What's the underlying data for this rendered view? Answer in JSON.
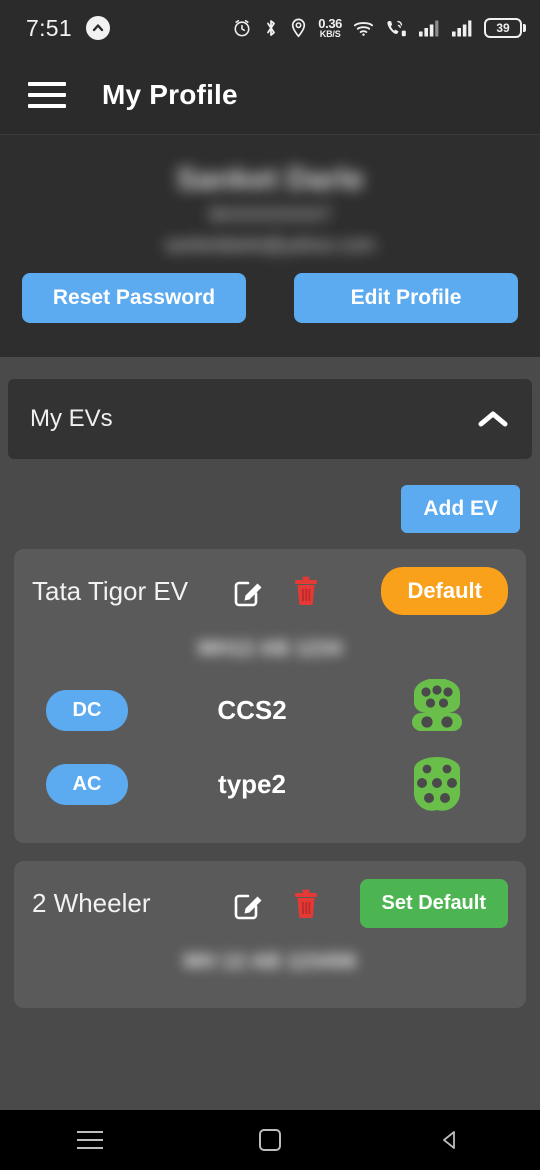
{
  "status_bar": {
    "time": "7:51",
    "app_icon": "caret-up-circle-icon",
    "icons": [
      "alarm-icon",
      "bluetooth-icon",
      "location-icon",
      "wifi-icon",
      "call-data-icon",
      "signal-bars-icon",
      "signal-bars-2-icon"
    ],
    "network_speed_value": "0.36",
    "network_speed_unit": "KB/S",
    "battery_level": "39"
  },
  "app_bar": {
    "menu_icon": "hamburger-menu-icon",
    "title": "My Profile"
  },
  "profile": {
    "name": "Sanket Darle",
    "phone": "9XXXXXXXX7",
    "email": "sanketdarle@yahoo.com",
    "reset_password_label": "Reset Password",
    "edit_profile_label": "Edit Profile"
  },
  "accordion": {
    "title": "My EVs",
    "chevron_icon": "chevron-up-icon",
    "expanded": true
  },
  "add_ev": {
    "label": "Add EV"
  },
  "ev_cards": [
    {
      "name": "Tata Tigor EV",
      "edit_icon": "edit-pencil-icon",
      "delete_icon": "trash-icon",
      "status_label": "Default",
      "status_type": "default",
      "registration": "MH12 AB 1234",
      "connectors": [
        {
          "current": "DC",
          "type": "CCS2",
          "icon": "ccs2-connector-icon"
        },
        {
          "current": "AC",
          "type": "type2",
          "icon": "type2-connector-icon"
        }
      ]
    },
    {
      "name": "2 Wheeler",
      "edit_icon": "edit-pencil-icon",
      "delete_icon": "trash-icon",
      "status_label": "Set Default",
      "status_type": "set-default",
      "registration": "MH 12 AB 123456",
      "connectors": []
    }
  ],
  "nav_bar": {
    "recents_icon": "recents-icon",
    "home_icon": "home-square-icon",
    "back_icon": "back-triangle-icon"
  },
  "colors": {
    "accent_blue": "#5cabf0",
    "default_orange": "#f9a11b",
    "set_default_green": "#4cb552",
    "delete_red": "#e53935",
    "connector_green": "#6abf4b",
    "app_bar_bg": "#2b2b2b",
    "body_bg": "#4a4a4a",
    "card_bg": "#5a5a5a"
  }
}
